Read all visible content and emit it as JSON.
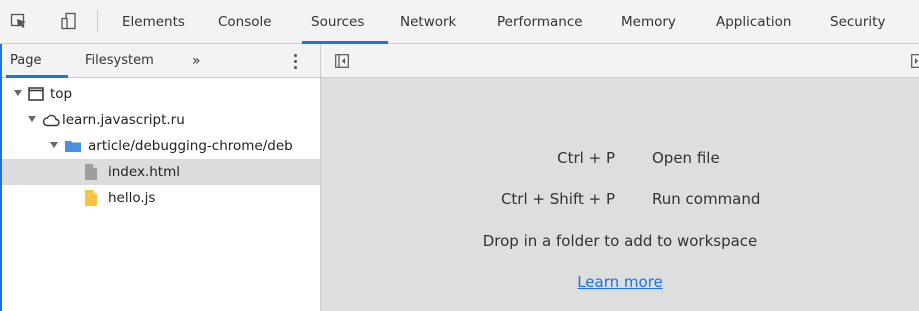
{
  "main_tabs": [
    {
      "label": "Elements"
    },
    {
      "label": "Console"
    },
    {
      "label": "Sources"
    },
    {
      "label": "Network"
    },
    {
      "label": "Performance"
    },
    {
      "label": "Memory"
    },
    {
      "label": "Application"
    },
    {
      "label": "Security"
    }
  ],
  "active_tab": "Sources",
  "navigator": {
    "tabs": [
      {
        "label": "Page"
      },
      {
        "label": "Filesystem"
      }
    ],
    "more_label": "»",
    "tree": [
      {
        "label": "top",
        "icon": "frame-icon"
      },
      {
        "label": "learn.javascript.ru",
        "icon": "cloud-icon"
      },
      {
        "label": "article/debugging-chrome/deb",
        "icon": "folder-icon"
      },
      {
        "label": "index.html",
        "icon": "file-icon",
        "selected": true
      },
      {
        "label": "hello.js",
        "icon": "js-file-icon"
      }
    ]
  },
  "editor_empty": {
    "shortcuts": [
      {
        "keys": "Ctrl + P",
        "action": "Open file"
      },
      {
        "keys": "Ctrl + Shift + P",
        "action": "Run command"
      }
    ],
    "drop_hint": "Drop in a folder to add to workspace",
    "learn_more": "Learn more"
  },
  "colors": {
    "accent": "#1a73e8",
    "editor_bg": "#dedede",
    "folder": "#4a90e2",
    "js_file": "#f3c63f",
    "html_file": "#9e9e9e"
  }
}
